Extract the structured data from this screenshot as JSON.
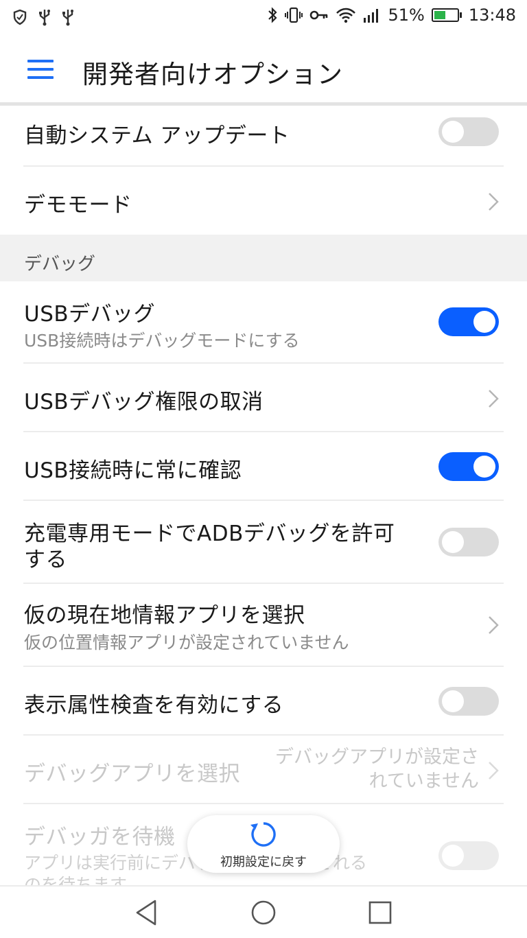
{
  "status_bar": {
    "battery_percent": "51%",
    "battery_level": 0.51,
    "time": "13:48",
    "icons": [
      "shield-icon",
      "usb-icon",
      "usb-icon",
      "bluetooth-icon",
      "vibrate-icon",
      "vpn-key-icon",
      "wifi-icon",
      "signal-icon",
      "battery-charging-icon"
    ]
  },
  "app_bar": {
    "title": "開発者向けオプション",
    "menu_icon": "hamburger-menu-icon",
    "accent_color": "#1e6ff5"
  },
  "rows": {
    "auto_update": {
      "title": "自動システム アップデート",
      "toggle": false
    },
    "demo_mode": {
      "title": "デモモード"
    },
    "debug_section": "デバッグ",
    "usb_debug": {
      "title": "USBデバッグ",
      "subtitle": "USB接続時はデバッグモードにする",
      "toggle": true
    },
    "revoke_usb": {
      "title": "USBデバッグ権限の取消"
    },
    "always_confirm": {
      "title": "USB接続時に常に確認",
      "toggle": true
    },
    "adb_charge_only": {
      "title_line1": "充電専用モードでADBデバッグを許可",
      "title_line2": "する",
      "toggle": false
    },
    "mock_location": {
      "title": "仮の現在地情報アプリを選択",
      "subtitle": "仮の位置情報アプリが設定されていません"
    },
    "view_attr": {
      "title": "表示属性検査を有効にする",
      "toggle": false
    },
    "debug_app": {
      "title": "デバッグアプリを選択",
      "value_line1": "デバッグアプリが設定さ",
      "value_line2": "れていません",
      "disabled": true
    },
    "wait_debugger": {
      "title": "デバッガを待機",
      "subtitle_line1": "アプリは実行前にデバッガのアタッチされる",
      "subtitle_line2": "のを待ちます",
      "toggle": false,
      "disabled": true
    }
  },
  "fab": {
    "label": "初期設定に戻す",
    "icon": "reset-icon"
  },
  "nav_bar": {
    "icons": [
      "back-icon",
      "home-icon",
      "recents-icon"
    ]
  },
  "colors": {
    "toggle_on": "#0a5fff",
    "toggle_off": "#dcdcdc",
    "battery_fill": "#2bb34a"
  }
}
